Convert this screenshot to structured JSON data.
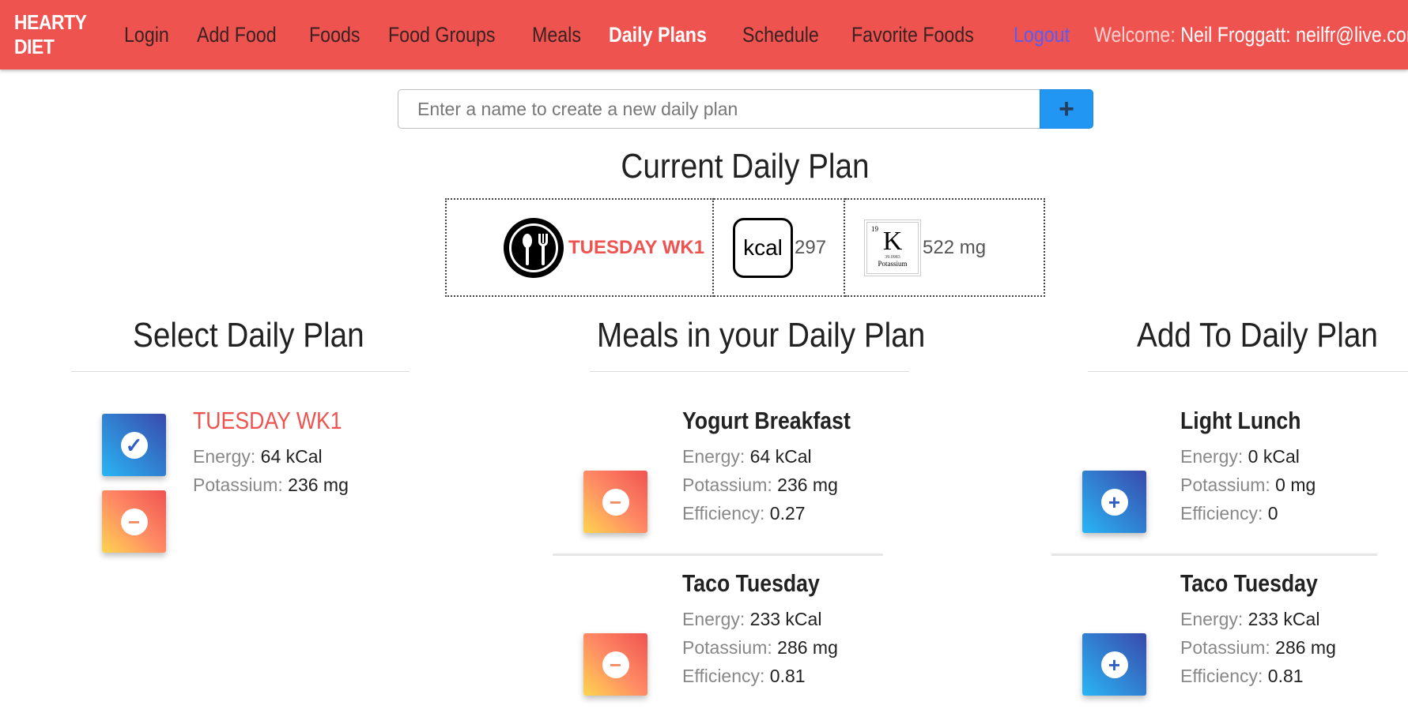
{
  "nav": {
    "brand": "HEARTY DIET",
    "items": [
      {
        "label": "Login"
      },
      {
        "label": "Add Food"
      },
      {
        "label": "Foods"
      },
      {
        "label": "Food Groups"
      },
      {
        "label": "Meals"
      },
      {
        "label": "Daily Plans"
      },
      {
        "label": "Schedule"
      },
      {
        "label": "Favorite Foods"
      }
    ],
    "logout": "Logout",
    "welcome_label": "Welcome:",
    "user": "Neil Froggatt: neilfr@live.com"
  },
  "create": {
    "placeholder": "Enter a name to create a new daily plan",
    "button": "+"
  },
  "current": {
    "title": "Current Daily Plan",
    "plan_name": "TUESDAY WK1",
    "kcal_icon": "kcal",
    "kcal_value": "297",
    "potassium_value": "522 mg",
    "k_icon": {
      "number": "19",
      "symbol": "K",
      "small": "39.0983",
      "name": "Potassium"
    }
  },
  "labels": {
    "energy": "Energy:",
    "potassium": "Potassium:",
    "efficiency": "Efficiency:"
  },
  "select": {
    "heading": "Select Daily Plan",
    "plans": [
      {
        "name": "TUESDAY WK1",
        "energy": "64 kCal",
        "potassium": "236 mg"
      }
    ]
  },
  "meals": {
    "heading": "Meals in your Daily Plan",
    "items": [
      {
        "name": "Yogurt Breakfast",
        "energy": "64 kCal",
        "potassium": "236 mg",
        "efficiency": "0.27"
      },
      {
        "name": "Taco Tuesday",
        "energy": "233 kCal",
        "potassium": "286 mg",
        "efficiency": "0.81"
      }
    ]
  },
  "add": {
    "heading": "Add To Daily Plan",
    "items": [
      {
        "name": "Light Lunch",
        "energy": "0 kCal",
        "potassium": "0 mg",
        "efficiency": "0"
      },
      {
        "name": "Taco Tuesday",
        "energy": "233 kCal",
        "potassium": "286 mg",
        "efficiency": "0.81"
      }
    ]
  },
  "icons": {
    "check": "check-circle-icon",
    "remove": "minus-circle-icon",
    "add": "plus-circle-icon"
  },
  "colors": {
    "navbar": "#ef5350",
    "accent_blue": "#2196f3",
    "plan_red": "#ef5350"
  }
}
